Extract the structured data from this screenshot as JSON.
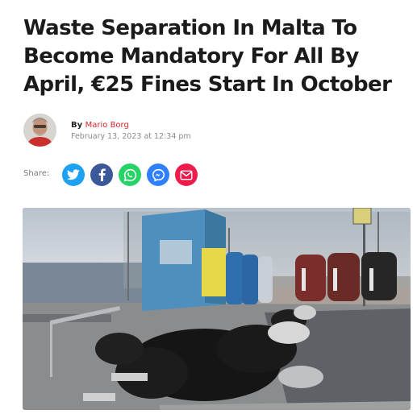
{
  "article": {
    "headline": "Waste Separation In Malta To Become Mandatory For All By April, €25 Fines Start In October"
  },
  "byline": {
    "by": "By",
    "author": "Mario Borg",
    "date": "February 13, 2023 at 12:34 pm"
  },
  "share": {
    "label": "Share:",
    "buttons": [
      {
        "network": "twitter",
        "icon": "twitter-icon",
        "color": "#1da1f2"
      },
      {
        "network": "facebook",
        "icon": "facebook-icon",
        "color": "#3b5998"
      },
      {
        "network": "whatsapp",
        "icon": "whatsapp-icon",
        "color": "#25d366"
      },
      {
        "network": "messenger",
        "icon": "messenger-icon",
        "color": "#2f80ff"
      },
      {
        "network": "email",
        "icon": "mail-icon",
        "color": "#ef1c4b"
      }
    ]
  },
  "colors": {
    "headline": "#1b1b1b",
    "author_link": "#d6262c",
    "meta_text": "#8a8a8a"
  }
}
